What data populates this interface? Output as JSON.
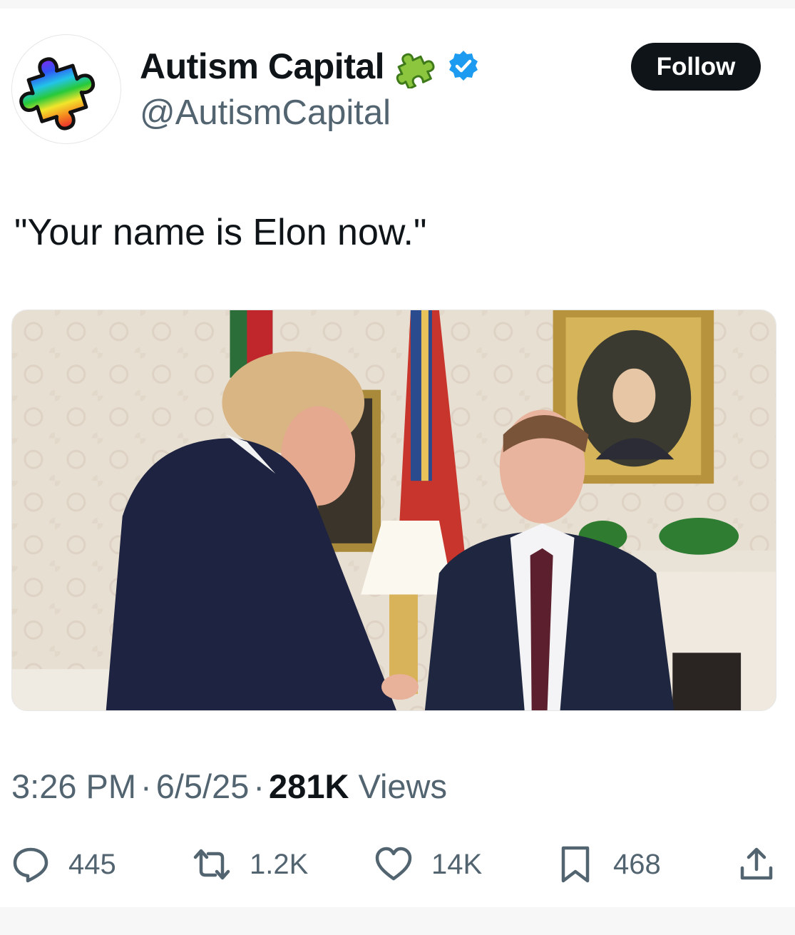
{
  "author": {
    "display_name": "Autism Capital",
    "handle": "@AutismCapital",
    "avatar_icon": "rainbow-puzzle-piece-icon",
    "name_emoji_icon": "puzzle-piece-emoji-icon",
    "verified_icon": "verified-badge-icon",
    "verified_color": "#1d9bf0"
  },
  "follow_label": "Follow",
  "tweet": {
    "text": "\"Your name is Elon now.\"",
    "media_icon": "photo"
  },
  "meta": {
    "time": "3:26 PM",
    "dot1": "·",
    "date": "6/5/25",
    "dot2": "·",
    "views_count": "281K",
    "views_label": "Views"
  },
  "actions": {
    "replies": "445",
    "reposts": "1.2K",
    "likes": "14K",
    "bookmarks": "468"
  },
  "colors": {
    "text_primary": "#0f1419",
    "text_secondary": "#536471",
    "button_bg": "#0f1419"
  }
}
